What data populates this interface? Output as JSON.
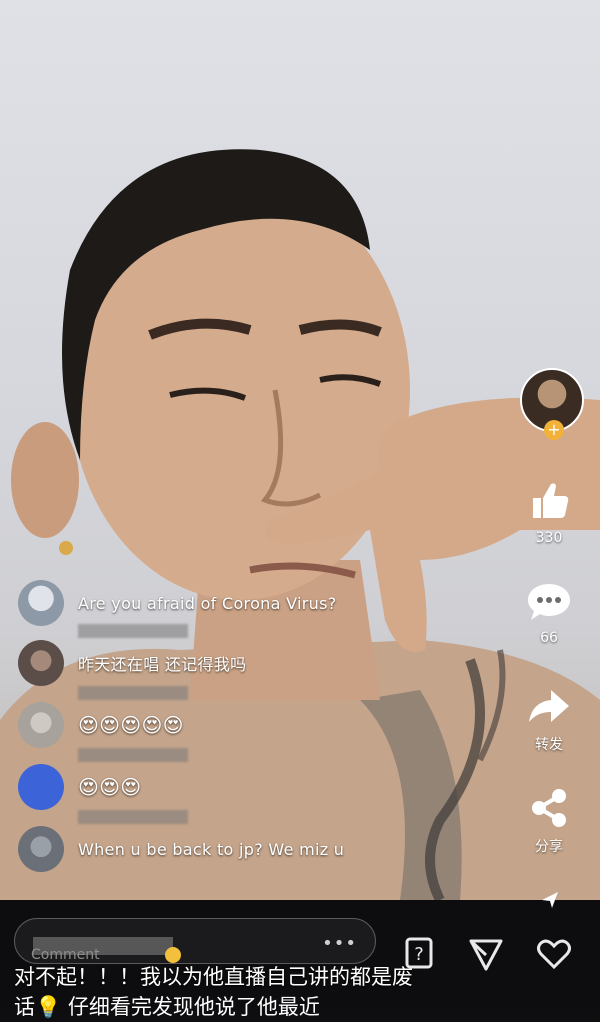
{
  "side_actions": {
    "likes": "330",
    "comments": "66",
    "share_label": "转发",
    "share2_label": "分享"
  },
  "comments": [
    {
      "text": "Are you afraid of Corona Virus?",
      "avatar_color": "#8d99a6"
    },
    {
      "text": "昨天还在唱 还记得我吗",
      "avatar_color": "#5b4e48"
    },
    {
      "text": "😍😍😍😍😍",
      "avatar_color": "#a8a29c"
    },
    {
      "text": "😍😍😍",
      "avatar_color": "#3d63d8"
    },
    {
      "text": "When u be back to jp? We miz u",
      "avatar_color": "#6a6f78"
    }
  ],
  "input": {
    "placeholder": "Comment"
  },
  "caption": {
    "line1": "对不起！！！我以为他直播自己讲的都是废",
    "line2": "话💡 仔细看完发现他说了他最近"
  },
  "icons": {
    "like": "thumbs-up-icon",
    "comment": "speech-bubble-icon",
    "share": "share-arrow-icon",
    "share2": "share-nodes-icon",
    "send": "send-icon",
    "question": "question-icon",
    "heart": "heart-icon"
  },
  "colors": {
    "accent_gold": "#f2b23a",
    "bottom_bar": "#0d0d0f"
  }
}
